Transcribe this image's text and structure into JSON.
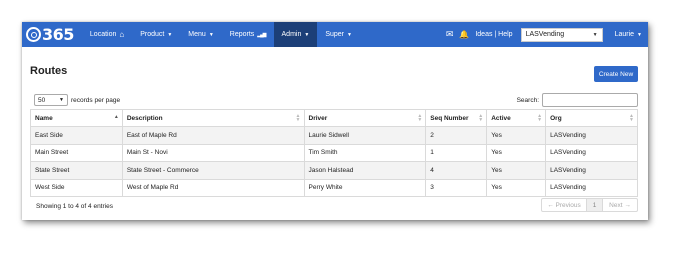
{
  "brand": {
    "name": "365"
  },
  "nav": {
    "items": [
      {
        "label": "Location",
        "icon": "home-icon",
        "glyph": "⌂"
      },
      {
        "label": "Product",
        "caret": "▼"
      },
      {
        "label": "Menu",
        "caret": "▼"
      },
      {
        "label": "Reports",
        "icon": "bar-chart-icon",
        "glyph": "▂▄▆"
      },
      {
        "label": "Admin",
        "caret": "▼",
        "active": true
      },
      {
        "label": "Super",
        "caret": "▼"
      }
    ],
    "mail_glyph": "✉",
    "bell_glyph": "🔔",
    "ideas_help": "Ideas | Help",
    "org_select": "LASVending",
    "user": "Laurie"
  },
  "page": {
    "title": "Routes",
    "create_button": "Create New",
    "length_value": "50",
    "length_label": "records per page",
    "search_label": "Search:",
    "search_value": ""
  },
  "table": {
    "columns": [
      "Name",
      "Description",
      "Driver",
      "Seq Number",
      "Active",
      "Org"
    ],
    "rows": [
      [
        "East Side",
        "East of Maple Rd",
        "Laurie Sidwell",
        "2",
        "Yes",
        "LASVending"
      ],
      [
        "Main Street",
        "Main St - Novi",
        "Tim Smith",
        "1",
        "Yes",
        "LASVending"
      ],
      [
        "State Street",
        "State Street - Commerce",
        "Jason Halstead",
        "4",
        "Yes",
        "LASVending"
      ],
      [
        "West Side",
        "West of Maple Rd",
        "Perry White",
        "3",
        "Yes",
        "LASVending"
      ]
    ]
  },
  "footer": {
    "info": "Showing 1 to 4 of 4 entries",
    "prev": "← Previous",
    "page": "1",
    "next": "Next →"
  },
  "colors": {
    "accent": "#2f69c9",
    "nav_active": "#1c3f78"
  }
}
